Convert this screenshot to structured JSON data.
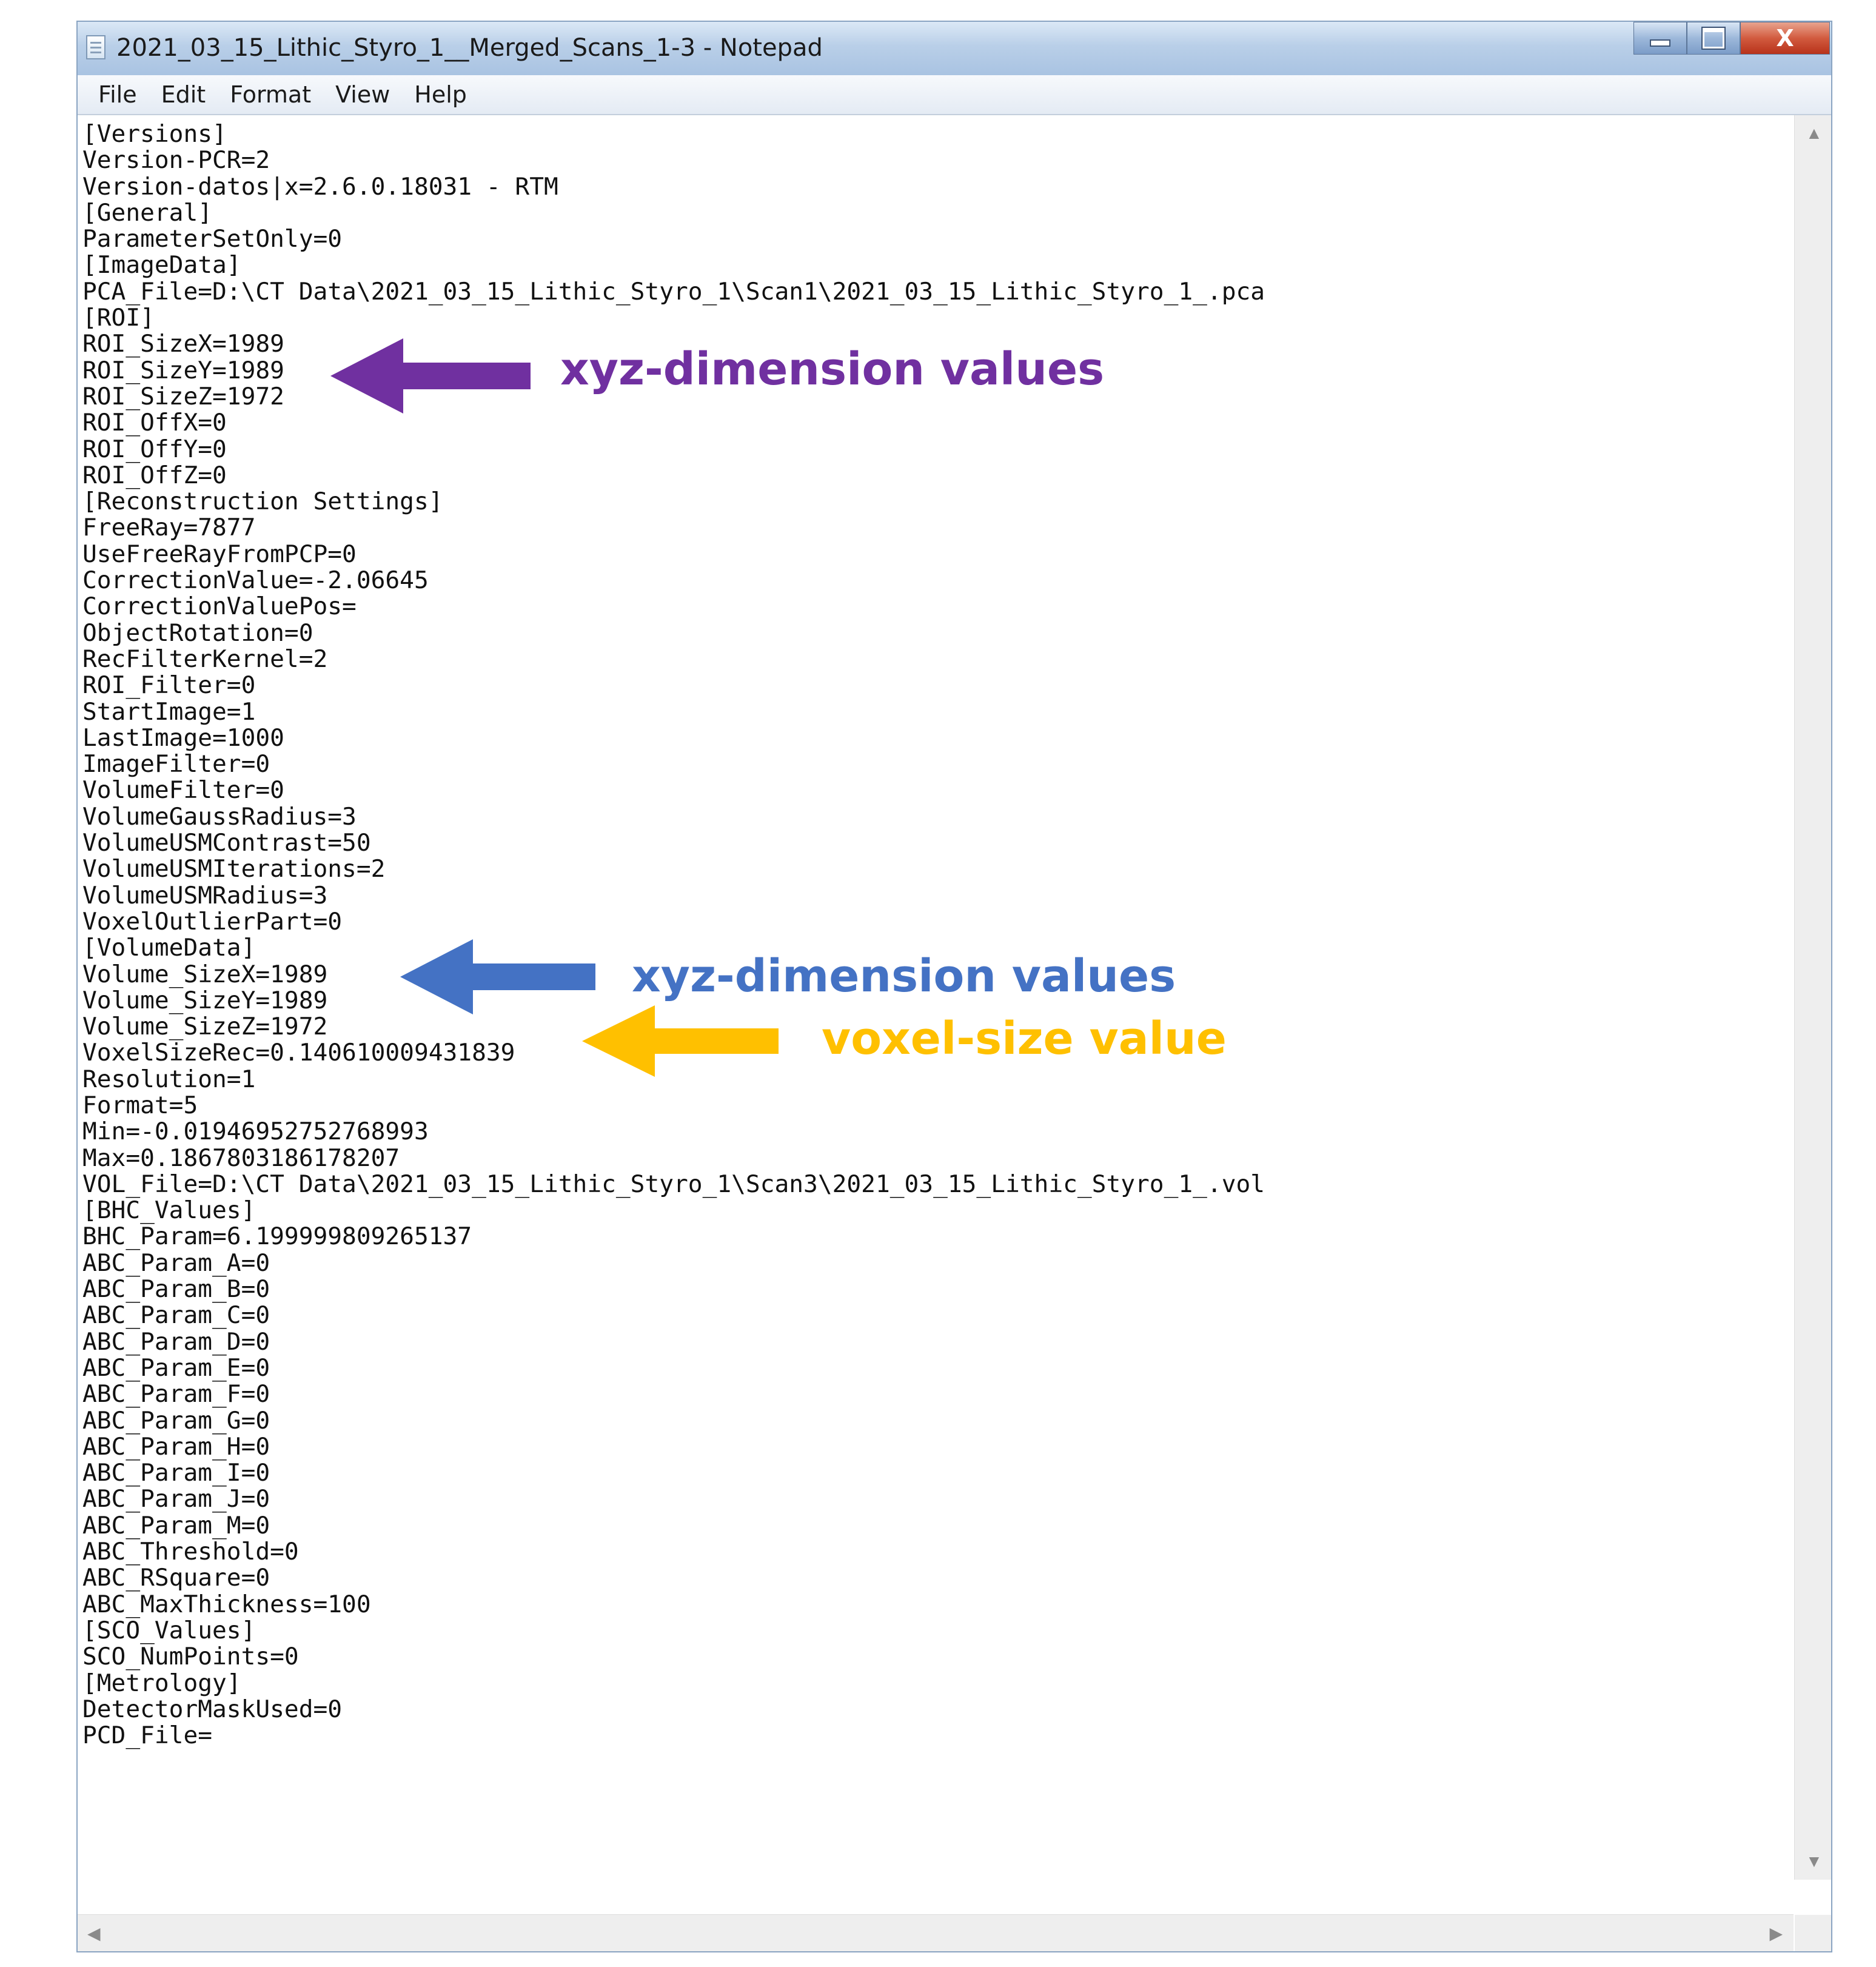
{
  "window": {
    "title": "2021_03_15_Lithic_Styro_1__Merged_Scans_1-3 - Notepad",
    "controls": {
      "close": "X"
    }
  },
  "menu": [
    "File",
    "Edit",
    "Format",
    "View",
    "Help"
  ],
  "document": {
    "text": "[Versions]\nVersion-PCR=2\nVersion-datos|x=2.6.0.18031 - RTM\n[General]\nParameterSetOnly=0\n[ImageData]\nPCA_File=D:\\CT Data\\2021_03_15_Lithic_Styro_1\\Scan1\\2021_03_15_Lithic_Styro_1_.pca\n[ROI]\nROI_SizeX=1989\nROI_SizeY=1989\nROI_SizeZ=1972\nROI_OffX=0\nROI_OffY=0\nROI_OffZ=0\n[Reconstruction Settings]\nFreeRay=7877\nUseFreeRayFromPCP=0\nCorrectionValue=-2.06645\nCorrectionValuePos=\nObjectRotation=0\nRecFilterKernel=2\nROI_Filter=0\nStartImage=1\nLastImage=1000\nImageFilter=0\nVolumeFilter=0\nVolumeGaussRadius=3\nVolumeUSMContrast=50\nVolumeUSMIterations=2\nVolumeUSMRadius=3\nVoxelOutlierPart=0\n[VolumeData]\nVolume_SizeX=1989\nVolume_SizeY=1989\nVolume_SizeZ=1972\nVoxelSizeRec=0.140610009431839\nResolution=1\nFormat=5\nMin=-0.0194695275276899​3\nMax=0.1867803186178207\nVOL_File=D:\\CT Data\\2021_03_15_Lithic_Styro_1\\Scan3\\2021_03_15_Lithic_Styro_1_.vol\n[BHC_Values]\nBHC_Param=6.199999809265137\nABC_Param_A=0\nABC_Param_B=0\nABC_Param_C=0\nABC_Param_D=0\nABC_Param_E=0\nABC_Param_F=0\nABC_Param_G=0\nABC_Param_H=0\nABC_Param_I=0\nABC_Param_J=0\nABC_Param_M=0\nABC_Threshold=0\nABC_RSquare=0\nABC_MaxThickness=100\n[SCO_Values]\nSCO_NumPoints=0\n[Metrology]\nDetectorMaskUsed=0\nPCD_File="
  },
  "annotations": {
    "roi": {
      "label": "xyz-dimension values",
      "color": "#7030a0"
    },
    "volume": {
      "label": "xyz-dimension values",
      "color": "#4472c4"
    },
    "voxel": {
      "label": "voxel-size value",
      "color": "#ffc000"
    }
  },
  "icons": {
    "app": "notepad-icon",
    "scroll_up": "chevron-up-icon",
    "scroll_down": "chevron-down-icon",
    "scroll_left": "chevron-left-icon",
    "scroll_right": "chevron-right-icon"
  }
}
